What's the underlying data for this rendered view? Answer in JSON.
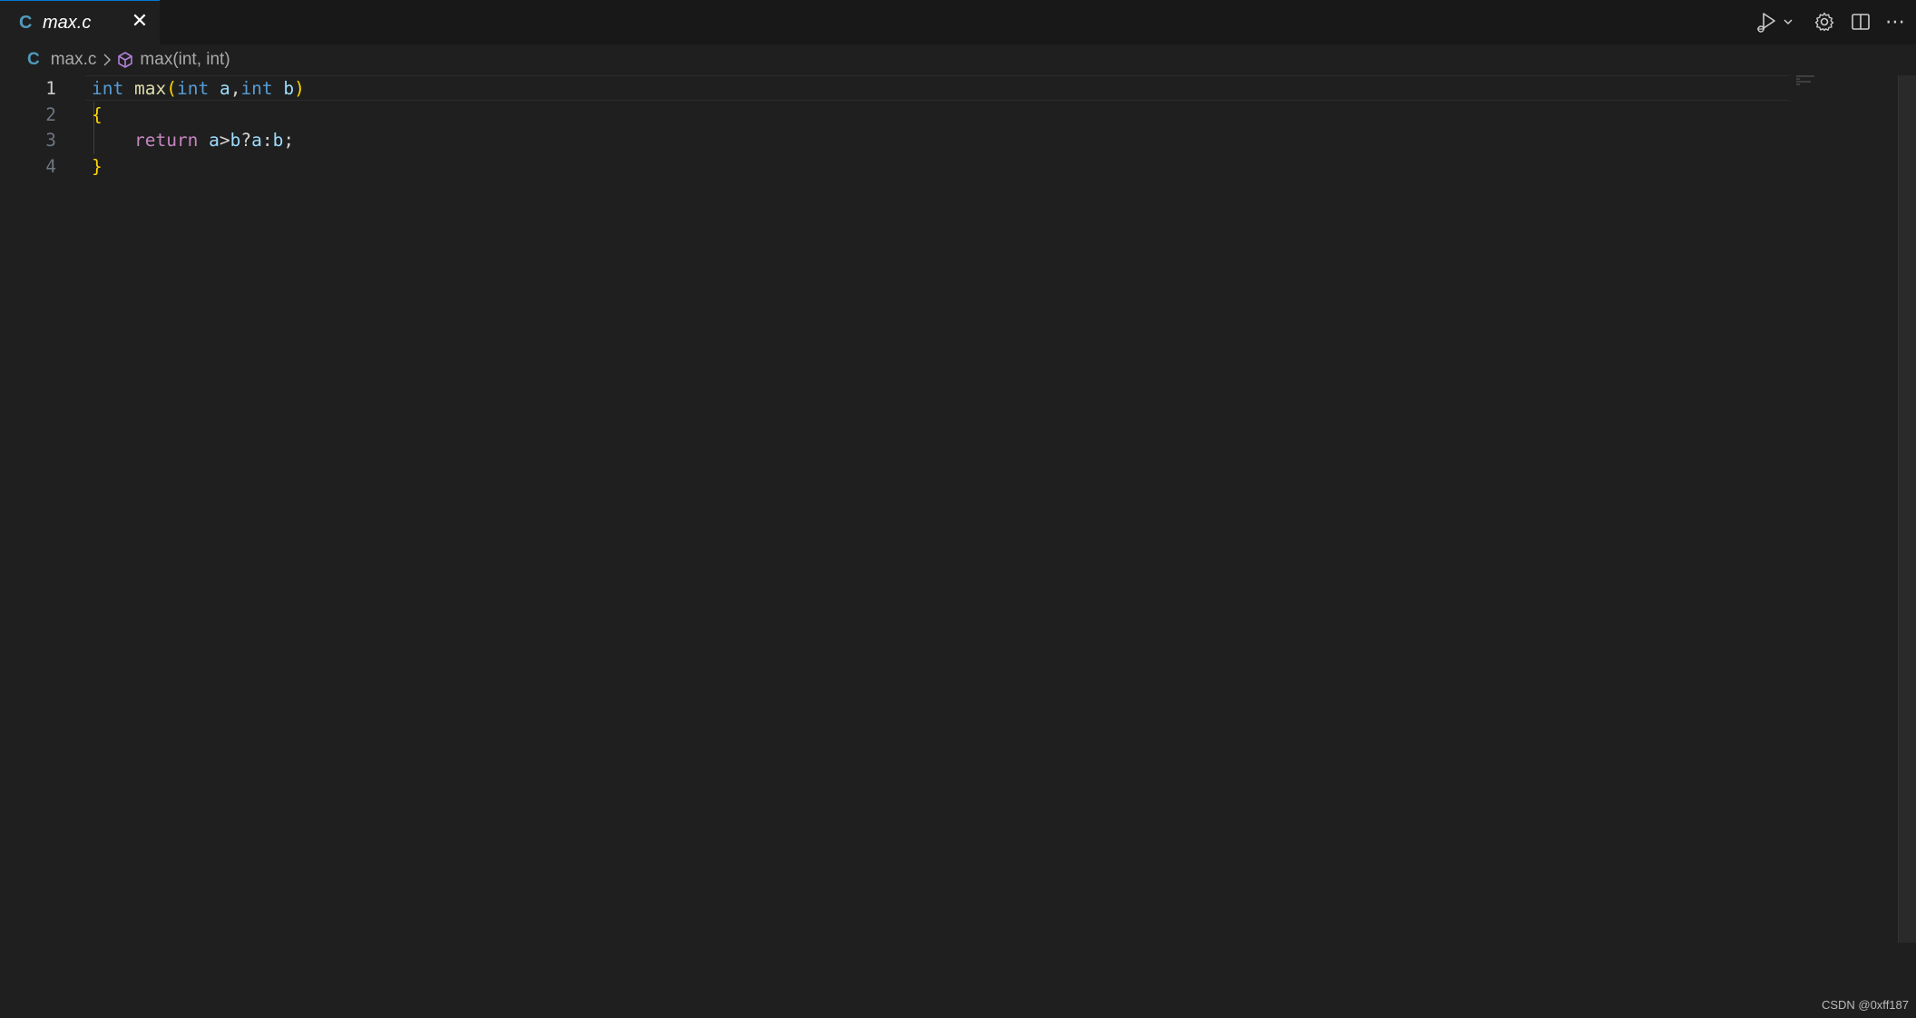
{
  "tab": {
    "lang_badge": "C",
    "title": "max.c",
    "close_glyph": "✕"
  },
  "toolbar": {
    "icons": [
      "run-debug-icon",
      "chevron-down-icon",
      "gear-icon",
      "split-editor-icon",
      "more-actions-icon"
    ],
    "more_glyph": "⋯"
  },
  "breadcrumb": {
    "lang_badge": "C",
    "file": "max.c",
    "symbol": "max(int, int)"
  },
  "editor": {
    "line_numbers": [
      "1",
      "2",
      "3",
      "4"
    ],
    "active_line": 1,
    "lines": [
      [
        {
          "t": "int",
          "c": "kw"
        },
        {
          "t": " ",
          "c": "op"
        },
        {
          "t": "max",
          "c": "fn"
        },
        {
          "t": "(",
          "c": "pn"
        },
        {
          "t": "int",
          "c": "kw"
        },
        {
          "t": " a",
          "c": "var"
        },
        {
          "t": ",",
          "c": "op"
        },
        {
          "t": "int",
          "c": "kw"
        },
        {
          "t": " b",
          "c": "var"
        },
        {
          "t": ")",
          "c": "pn"
        }
      ],
      [
        {
          "t": "{",
          "c": "pn"
        }
      ],
      [
        {
          "t": "    ",
          "c": "op"
        },
        {
          "t": "return",
          "c": "ret"
        },
        {
          "t": " a",
          "c": "var"
        },
        {
          "t": ">",
          "c": "op"
        },
        {
          "t": "b",
          "c": "var"
        },
        {
          "t": "?",
          "c": "op"
        },
        {
          "t": "a",
          "c": "var"
        },
        {
          "t": ":",
          "c": "op"
        },
        {
          "t": "b",
          "c": "var"
        },
        {
          "t": ";",
          "c": "op"
        }
      ],
      [
        {
          "t": "}",
          "c": "pn"
        }
      ]
    ]
  },
  "watermark": "CSDN @0xff187",
  "colors": {
    "background": "#1f1f1f",
    "keyword": "#569cd6",
    "function": "#dcdcaa",
    "bracket": "#ffd700",
    "control": "#c586c0",
    "variable": "#9cdcfe",
    "lang_badge": "#519aba"
  }
}
